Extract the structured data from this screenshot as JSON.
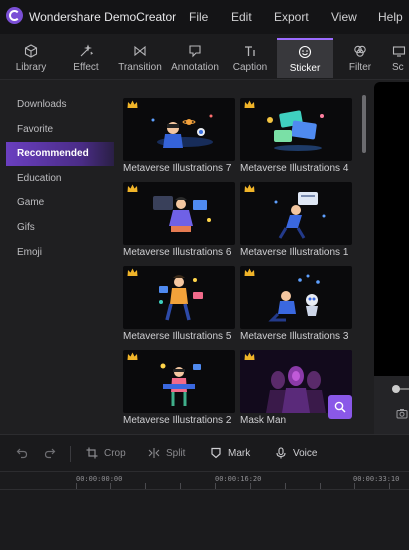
{
  "app": {
    "title": "Wondershare DemoCreator"
  },
  "menu": [
    "File",
    "Edit",
    "Export",
    "View",
    "Help"
  ],
  "tabs": [
    {
      "label": "Library",
      "icon": "cube-icon"
    },
    {
      "label": "Effect",
      "icon": "magic-wand-icon"
    },
    {
      "label": "Transition",
      "icon": "transition-icon"
    },
    {
      "label": "Annotation",
      "icon": "annotation-icon"
    },
    {
      "label": "Caption",
      "icon": "caption-icon"
    },
    {
      "label": "Sticker",
      "icon": "smiley-icon",
      "active": true
    },
    {
      "label": "Filter",
      "icon": "filter-icon"
    },
    {
      "label": "Sc",
      "icon": "screen-icon"
    }
  ],
  "sidebar": {
    "items": [
      {
        "label": "Downloads"
      },
      {
        "label": "Favorite"
      },
      {
        "label": "Recommended",
        "active": true
      },
      {
        "label": "Education"
      },
      {
        "label": "Game"
      },
      {
        "label": "Gifs"
      },
      {
        "label": "Emoji"
      }
    ]
  },
  "stickers": [
    {
      "label": "Metaverse Illustrations 7",
      "premium": true
    },
    {
      "label": "Metaverse Illustrations 4",
      "premium": true
    },
    {
      "label": "Metaverse Illustrations 6",
      "premium": true
    },
    {
      "label": "Metaverse Illustrations 1",
      "premium": true
    },
    {
      "label": "Metaverse Illustrations 5",
      "premium": true
    },
    {
      "label": "Metaverse Illustrations 3",
      "premium": true
    },
    {
      "label": "Metaverse Illustrations 2",
      "premium": true
    },
    {
      "label": "Mask Man",
      "premium": true
    }
  ],
  "toolbar": {
    "crop": "Crop",
    "split": "Split",
    "mark": "Mark",
    "voice": "Voice"
  },
  "timeline": {
    "timecodes": [
      "00:00:00:00",
      "00:00:16:20",
      "00:00:33:10"
    ]
  },
  "colors": {
    "accent": "#8a58e8",
    "crown": "#f0b429"
  }
}
